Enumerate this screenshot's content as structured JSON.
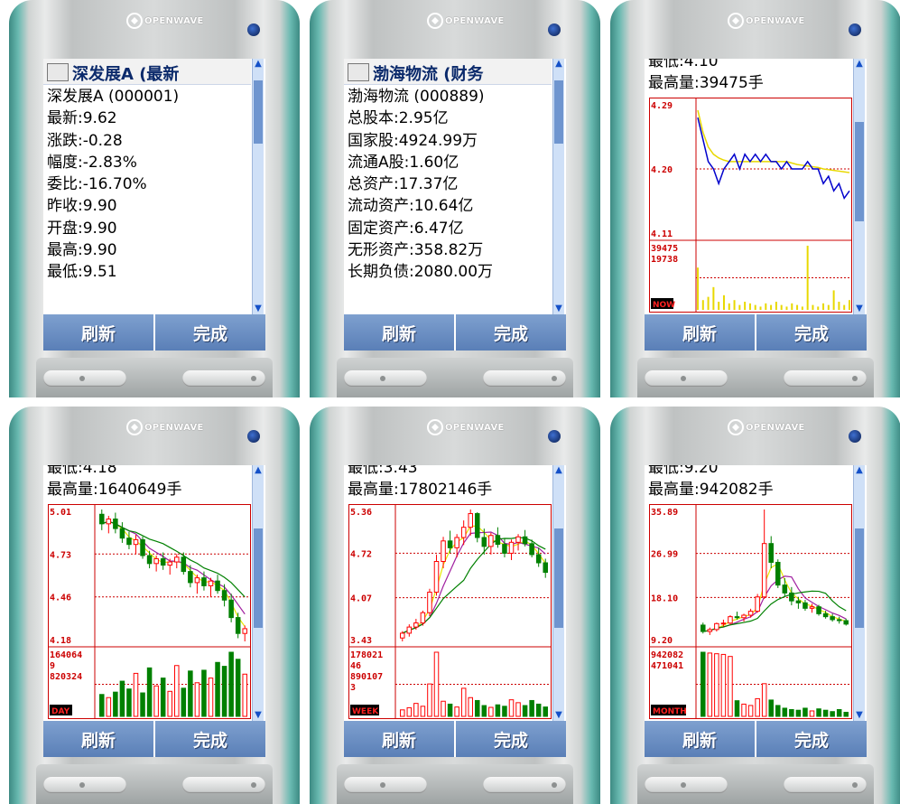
{
  "brand": {
    "name": "OPENWAVE"
  },
  "softkeys": {
    "refresh": "刷新",
    "done": "完成"
  },
  "phones": [
    {
      "title": "深发展A (最新",
      "lines": [
        "深发展A (000001)",
        "最新:9.62",
        "涨跌:-0.28",
        "幅度:-2.83%",
        "委比:-16.70%",
        "昨收:9.90",
        "开盘:9.90",
        "最高:9.90",
        "最低:9.51"
      ]
    },
    {
      "title": "渤海物流 (财务",
      "lines": [
        "渤海物流 (000889)",
        "总股本:2.95亿",
        "国家股:4924.99万",
        "流通A股:1.60亿",
        "总资产:17.37亿",
        "流动资产:10.64亿",
        "固定资产:6.47亿",
        "无形资产:358.82万",
        "长期负债:2080.00万"
      ]
    },
    {
      "cut_line": "最低:4.10",
      "max_line": "最高量:39475手",
      "price_labels": [
        "4.29",
        "4.20",
        "4.11"
      ],
      "vol_labels": [
        "39475",
        "19738"
      ],
      "tag": "NOW"
    },
    {
      "cut_line": "最低:4.18",
      "max_line": "最高量:1640649手",
      "price_labels": [
        "5.01",
        "4.73",
        "4.46",
        "4.18"
      ],
      "vol_labels": [
        "164064",
        "9",
        "820324"
      ],
      "tag": "DAY"
    },
    {
      "cut_line": "最低:3.43",
      "max_line": "最高量:17802146手",
      "price_labels": [
        "5.36",
        "4.72",
        "4.07",
        "3.43"
      ],
      "vol_labels": [
        "178021",
        "46",
        "890107",
        "3"
      ],
      "tag": "WEEK"
    },
    {
      "cut_line": "最低:9.20",
      "max_line": "最高量:942082手",
      "price_labels": [
        "35.89",
        "26.99",
        "18.10",
        "9.20"
      ],
      "vol_labels": [
        "942082",
        "471041"
      ],
      "tag": "MONTH"
    }
  ],
  "chart_data": [
    {
      "type": "line",
      "panel": "intraday",
      "price_range": [
        4.11,
        4.29
      ],
      "price_ticks": [
        4.29,
        4.2,
        4.11
      ],
      "price": [
        4.27,
        4.24,
        4.21,
        4.2,
        4.18,
        4.2,
        4.21,
        4.22,
        4.2,
        4.22,
        4.21,
        4.22,
        4.21,
        4.22,
        4.21,
        4.21,
        4.2,
        4.21,
        4.2,
        4.2,
        4.2,
        4.21,
        4.2,
        4.2,
        4.18,
        4.19,
        4.17,
        4.18,
        4.16,
        4.17
      ],
      "average": [
        4.28,
        4.25,
        4.23,
        4.22,
        4.215,
        4.212,
        4.21,
        4.21,
        4.21,
        4.21,
        4.21,
        4.21,
        4.21,
        4.21,
        4.21,
        4.21,
        4.21,
        4.21,
        4.208,
        4.206,
        4.205,
        4.204,
        4.203,
        4.202,
        4.2,
        4.199,
        4.198,
        4.197,
        4.196,
        4.195
      ],
      "volume_range": [
        0,
        39475
      ],
      "volume": [
        26000,
        6000,
        8000,
        14000,
        5000,
        9000,
        4000,
        6000,
        3000,
        5000,
        4000,
        3000,
        2000,
        4000,
        3000,
        5000,
        3000,
        2000,
        4000,
        3000,
        2000,
        39475,
        3000,
        2000,
        4000,
        3000,
        12000,
        5000,
        3000,
        6000
      ]
    },
    {
      "type": "candlestick",
      "panel": "daily",
      "price_range": [
        4.18,
        5.01
      ],
      "price_ticks": [
        5.01,
        4.73,
        4.46,
        4.18
      ],
      "volume_range": [
        0,
        1640649
      ],
      "ohlc": [
        [
          4.98,
          5.01,
          4.88,
          4.92
        ],
        [
          4.92,
          4.97,
          4.86,
          4.95
        ],
        [
          4.95,
          4.99,
          4.86,
          4.89
        ],
        [
          4.89,
          4.93,
          4.8,
          4.83
        ],
        [
          4.83,
          4.87,
          4.76,
          4.79
        ],
        [
          4.79,
          4.85,
          4.73,
          4.82
        ],
        [
          4.82,
          4.84,
          4.7,
          4.72
        ],
        [
          4.72,
          4.75,
          4.64,
          4.67
        ],
        [
          4.67,
          4.72,
          4.62,
          4.7
        ],
        [
          4.7,
          4.74,
          4.63,
          4.66
        ],
        [
          4.66,
          4.7,
          4.6,
          4.68
        ],
        [
          4.68,
          4.73,
          4.64,
          4.71
        ],
        [
          4.71,
          4.74,
          4.6,
          4.62
        ],
        [
          4.62,
          4.66,
          4.52,
          4.55
        ],
        [
          4.55,
          4.6,
          4.48,
          4.58
        ],
        [
          4.58,
          4.62,
          4.5,
          4.53
        ],
        [
          4.53,
          4.58,
          4.46,
          4.56
        ],
        [
          4.56,
          4.6,
          4.48,
          4.5
        ],
        [
          4.5,
          4.54,
          4.4,
          4.44
        ],
        [
          4.44,
          4.48,
          4.3,
          4.33
        ],
        [
          4.33,
          4.36,
          4.2,
          4.23
        ],
        [
          4.23,
          4.28,
          4.18,
          4.26
        ]
      ],
      "volume": [
        560000,
        480000,
        620000,
        900000,
        700000,
        1100000,
        600000,
        1240000,
        780000,
        980000,
        640000,
        1300000,
        720000,
        1160000,
        860000,
        1180000,
        980000,
        1380000,
        1280000,
        1640649,
        1460000,
        1080000
      ]
    },
    {
      "type": "candlestick",
      "panel": "weekly",
      "price_range": [
        3.43,
        5.36
      ],
      "price_ticks": [
        5.36,
        4.72,
        4.07,
        3.43
      ],
      "volume_range": [
        0,
        17802146
      ],
      "ohlc": [
        [
          3.48,
          3.58,
          3.43,
          3.55
        ],
        [
          3.55,
          3.68,
          3.5,
          3.64
        ],
        [
          3.64,
          3.76,
          3.6,
          3.7
        ],
        [
          3.7,
          3.88,
          3.66,
          3.85
        ],
        [
          3.85,
          4.2,
          3.8,
          4.15
        ],
        [
          4.15,
          4.7,
          4.1,
          4.6
        ],
        [
          4.6,
          4.96,
          4.5,
          4.9
        ],
        [
          4.9,
          5.05,
          4.72,
          4.8
        ],
        [
          4.8,
          5.0,
          4.66,
          4.95
        ],
        [
          4.95,
          5.2,
          4.84,
          5.1
        ],
        [
          5.1,
          5.36,
          4.98,
          5.3
        ],
        [
          5.3,
          5.32,
          4.88,
          4.95
        ],
        [
          4.95,
          5.08,
          4.7,
          4.82
        ],
        [
          4.82,
          5.02,
          4.7,
          4.98
        ],
        [
          4.98,
          5.1,
          4.8,
          4.85
        ],
        [
          4.85,
          4.94,
          4.66,
          4.72
        ],
        [
          4.72,
          4.92,
          4.62,
          4.88
        ],
        [
          4.88,
          5.0,
          4.76,
          4.96
        ],
        [
          4.96,
          5.06,
          4.82,
          4.86
        ],
        [
          4.86,
          4.92,
          4.66,
          4.7
        ],
        [
          4.7,
          4.8,
          4.52,
          4.58
        ],
        [
          4.58,
          4.64,
          4.36,
          4.44
        ]
      ],
      "volume": [
        1800000,
        2400000,
        3600000,
        2800000,
        9000000,
        17802146,
        4200000,
        3400000,
        2600000,
        7800000,
        5200000,
        4400000,
        3000000,
        2500000,
        3200000,
        2800000,
        4600000,
        3800000,
        3000000,
        4400000,
        3400000,
        2600000
      ]
    },
    {
      "type": "candlestick",
      "panel": "monthly",
      "price_range": [
        9.2,
        35.89
      ],
      "price_ticks": [
        35.89,
        26.99,
        18.1,
        9.2
      ],
      "volume_range": [
        0,
        942082
      ],
      "ohlc": [
        [
          12.5,
          13.0,
          10.8,
          11.2
        ],
        [
          11.2,
          12.0,
          10.5,
          11.6
        ],
        [
          11.6,
          13.0,
          11.2,
          12.8
        ],
        [
          12.8,
          13.6,
          12.2,
          12.9
        ],
        [
          12.9,
          14.5,
          12.6,
          14.2
        ],
        [
          14.2,
          15.2,
          13.6,
          14.0
        ],
        [
          14.0,
          14.8,
          13.2,
          14.5
        ],
        [
          14.5,
          15.8,
          14.0,
          15.3
        ],
        [
          15.3,
          18.8,
          15.0,
          18.2
        ],
        [
          18.2,
          35.89,
          17.8,
          29.0
        ],
        [
          29.0,
          30.5,
          24.0,
          25.2
        ],
        [
          25.2,
          25.8,
          20.0,
          20.6
        ],
        [
          20.6,
          22.0,
          18.2,
          19.0
        ],
        [
          19.0,
          20.2,
          16.5,
          17.4
        ],
        [
          17.4,
          18.2,
          15.8,
          17.0
        ],
        [
          17.0,
          17.6,
          15.4,
          15.9
        ],
        [
          15.9,
          16.8,
          15.0,
          16.2
        ],
        [
          16.2,
          16.6,
          14.4,
          14.8
        ],
        [
          14.8,
          15.4,
          13.8,
          14.2
        ],
        [
          14.2,
          14.8,
          13.2,
          13.6
        ],
        [
          13.6,
          14.2,
          12.8,
          13.4
        ],
        [
          13.4,
          13.8,
          12.4,
          12.7
        ]
      ],
      "volume": [
        942082,
        930000,
        920000,
        910000,
        880000,
        230000,
        180000,
        160000,
        260000,
        480000,
        240000,
        160000,
        120000,
        100000,
        90000,
        120000,
        80000,
        110000,
        90000,
        70000,
        100000,
        60000
      ]
    }
  ]
}
